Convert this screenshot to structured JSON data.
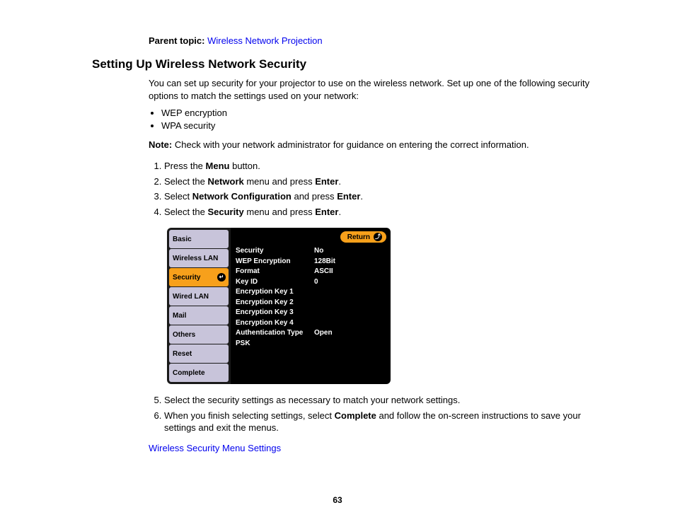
{
  "parent": {
    "label": "Parent topic:",
    "link": "Wireless Network Projection"
  },
  "heading": "Setting Up Wireless Network Security",
  "intro": "You can set up security for your projector to use on the wireless network. Set up one of the following security options to match the settings used on your network:",
  "bullets": [
    "WEP encryption",
    "WPA security"
  ],
  "note": {
    "label": "Note:",
    "text": "Check with your network administrator for guidance on entering the correct information."
  },
  "steps_a": [
    {
      "pre": "Press the ",
      "b": "Menu",
      "post": " button."
    },
    {
      "pre": "Select the ",
      "b": "Network",
      "post": " menu and press ",
      "b2": "Enter",
      "post2": "."
    },
    {
      "pre": "Select ",
      "b": "Network Configuration",
      "post": " and press ",
      "b2": "Enter",
      "post2": "."
    },
    {
      "pre": "Select the ",
      "b": "Security",
      "post": " menu and press ",
      "b2": "Enter",
      "post2": "."
    }
  ],
  "steps_b": [
    {
      "pre": "Select the security settings as necessary to match your network settings."
    },
    {
      "pre": "When you finish selecting settings, select ",
      "b": "Complete",
      "post": " and follow the on-screen instructions to save your settings and exit the menus."
    }
  ],
  "figure": {
    "tabs": [
      "Basic",
      "Wireless LAN",
      "Security",
      "Wired LAN",
      "Mail",
      "Others",
      "Reset",
      "Complete"
    ],
    "active_tab_index": 2,
    "return_label": "Return",
    "rows": [
      {
        "k": "Security",
        "v": "No"
      },
      {
        "k": "WEP Encryption",
        "v": "128Bit"
      },
      {
        "k": "Format",
        "v": "ASCII"
      },
      {
        "k": "Key ID",
        "v": "0"
      },
      {
        "k": "Encryption Key 1",
        "v": ""
      },
      {
        "k": "Encryption Key 2",
        "v": ""
      },
      {
        "k": "Encryption Key 3",
        "v": ""
      },
      {
        "k": "Encryption Key 4",
        "v": ""
      },
      {
        "k": "Authentication Type",
        "v": "Open"
      },
      {
        "k": "PSK",
        "v": ""
      }
    ]
  },
  "related_link": "Wireless Security Menu Settings",
  "page_number": "63"
}
